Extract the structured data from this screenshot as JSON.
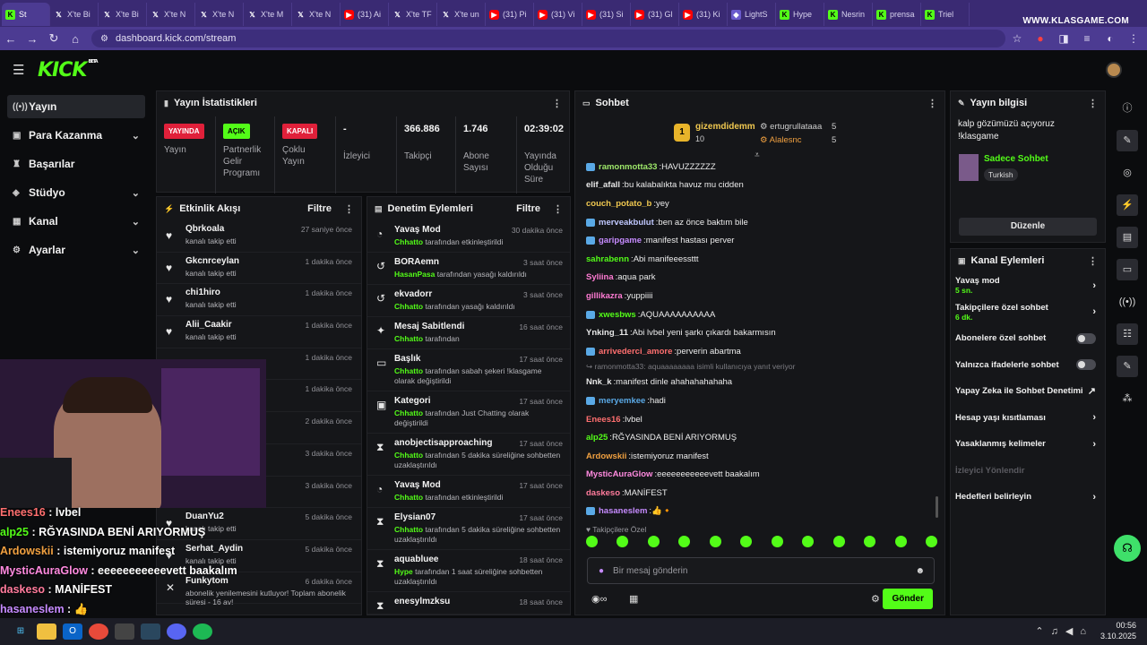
{
  "browser": {
    "tabs": [
      {
        "label": "St",
        "icon": "kick",
        "active": true
      },
      {
        "label": "X'te Bi",
        "icon": "x"
      },
      {
        "label": "X'te Bi",
        "icon": "x"
      },
      {
        "label": "X'te N",
        "icon": "x"
      },
      {
        "label": "X'te N",
        "icon": "x"
      },
      {
        "label": "X'te M",
        "icon": "x"
      },
      {
        "label": "X'te N",
        "icon": "x"
      },
      {
        "label": "(31) Ai",
        "icon": "yt"
      },
      {
        "label": "X'te TF",
        "icon": "x"
      },
      {
        "label": "X'te un",
        "icon": "x"
      },
      {
        "label": "(31) Pi",
        "icon": "yt"
      },
      {
        "label": "(31) Vi",
        "icon": "yt"
      },
      {
        "label": "(31) Si",
        "icon": "yt"
      },
      {
        "label": "(31) Gl",
        "icon": "yt"
      },
      {
        "label": "(31) Ki",
        "icon": "yt"
      },
      {
        "label": "LightS",
        "icon": "g"
      },
      {
        "label": "Hype",
        "icon": "kick"
      },
      {
        "label": "Nesrin",
        "icon": "kick"
      },
      {
        "label": "prensa",
        "icon": "kick"
      },
      {
        "label": "Triel",
        "icon": "kick"
      }
    ],
    "watermark": "WWW.KLASGAME.COM",
    "url": "dashboard.kick.com/stream"
  },
  "sidebar": {
    "items": [
      {
        "label": "Yayın",
        "icon": "stream-icon",
        "active": true,
        "expand": false
      },
      {
        "label": "Para Kazanma",
        "icon": "money-icon",
        "expand": true
      },
      {
        "label": "Başarılar",
        "icon": "trophy-icon",
        "expand": false
      },
      {
        "label": "Stüdyo",
        "icon": "studio-icon",
        "expand": true
      },
      {
        "label": "Kanal",
        "icon": "channel-icon",
        "expand": true
      },
      {
        "label": "Ayarlar",
        "icon": "gear-icon",
        "expand": true
      }
    ]
  },
  "stats": {
    "title": "Yayın İstatistikleri",
    "live_badge": "YAYINDA",
    "live_label": "Yayın",
    "partner_badge": "AÇIK",
    "partner_label": "Partnerlik Gelir Programı",
    "multi_badge": "KAPALI",
    "multi_label": "Çoklu Yayın",
    "viewers_value": "-",
    "viewers_label": "İzleyici",
    "followers_value": "366.886",
    "followers_label": "Takipçi",
    "subs_value": "1.746",
    "subs_label": "Abone Sayısı",
    "uptime_value": "02:39:02",
    "uptime_label": "Yayında Olduğu Süre"
  },
  "activity": {
    "title": "Etkinlik Akışı",
    "filter": "Filtre",
    "rows": [
      {
        "name": "Qbrkoala",
        "sub": "kanalı takip etti",
        "time": "27 saniye önce"
      },
      {
        "name": "Gkcnrceylan",
        "sub": "kanalı takip etti",
        "time": "1 dakika önce"
      },
      {
        "name": "chi1hiro",
        "sub": "kanalı takip etti",
        "time": "1 dakika önce"
      },
      {
        "name": "Alii_Caakir",
        "sub": "kanalı takip etti",
        "time": "1 dakika önce"
      },
      {
        "name": "",
        "sub": "",
        "time": "1 dakika önce"
      },
      {
        "name": "",
        "sub": "",
        "time": "1 dakika önce"
      },
      {
        "name": "",
        "sub": "",
        "time": "2 dakika önce"
      },
      {
        "name": "",
        "sub": "",
        "time": "3 dakika önce"
      },
      {
        "name": "",
        "sub": "",
        "time": "3 dakika önce"
      },
      {
        "name": "DuanYu2",
        "sub": "kanalı takip etti",
        "time": "5 dakika önce"
      },
      {
        "name": "Serhat_Aydin",
        "sub": "kanalı takip etti",
        "time": "5 dakika önce"
      },
      {
        "name": "Funkytom",
        "sub": "abonelik yenilemesini kutluyor! Toplam abonelik süresi - 16 av!",
        "time": "6 dakika önce"
      }
    ]
  },
  "moderation": {
    "title": "Denetim Eylemleri",
    "filter": "Filtre",
    "rows": [
      {
        "name": "Yavaş Mod",
        "actor": "Chhatto",
        "sub": "tarafından etkinleştirildi",
        "time": "30 dakika önce"
      },
      {
        "name": "BORAemn",
        "actor": "HasanPasa",
        "sub": "tarafından yasağı kaldırıldı",
        "time": "3 saat önce"
      },
      {
        "name": "ekvadorr",
        "actor": "Chhatto",
        "sub": "tarafından yasağı kaldırıldı",
        "time": "3 saat önce"
      },
      {
        "name": "Mesaj Sabitlendi",
        "actor": "Chhatto",
        "sub": "tarafından",
        "time": "16 saat önce"
      },
      {
        "name": "Başlık",
        "actor": "Chhatto",
        "sub": "tarafından sabah şekeri !klasgame olarak değiştirildi",
        "time": "17 saat önce"
      },
      {
        "name": "Kategori",
        "actor": "Chhatto",
        "sub": "tarafından Just Chatting olarak değiştirildi",
        "time": "17 saat önce"
      },
      {
        "name": "anobjectisapproaching",
        "actor": "Chhatto",
        "sub": "tarafından 5 dakika süreliğine sohbetten uzaklaştırıldı",
        "time": "17 saat önce"
      },
      {
        "name": "Yavaş Mod",
        "actor": "Chhatto",
        "sub": "tarafından etkinleştirildi",
        "time": "17 saat önce"
      },
      {
        "name": "Elysian07",
        "actor": "Chhatto",
        "sub": "tarafından 5 dakika süreliğine sohbetten uzaklaştırıldı",
        "time": "17 saat önce"
      },
      {
        "name": "aquabluee",
        "actor": "Hype",
        "sub": "tarafından 1 saat süreliğine sohbetten uzaklaştırıldı",
        "time": "18 saat önce"
      },
      {
        "name": "enesylmzksu",
        "actor": "",
        "sub": "",
        "time": "18 saat önce"
      }
    ]
  },
  "chat": {
    "title": "Sohbet",
    "top": [
      {
        "rank": "1",
        "name": "gizemdidemm",
        "count": "10"
      },
      {
        "name": "ertugrullataaa",
        "count": "5"
      },
      {
        "name": "Alalesnc",
        "count": "5"
      }
    ],
    "messages": [
      {
        "user": "ramonmotta33",
        "color": "#9ee86a",
        "text": "HAVUZZZZZZ",
        "badge": true
      },
      {
        "user": "elif_afall",
        "color": "#e8e8e8",
        "text": "bu kalabalıkta havuz mu cidden"
      },
      {
        "user": "couch_potato_b",
        "color": "#f0c850",
        "text": "yey"
      },
      {
        "user": "merveakbulut",
        "color": "#c0c8ff",
        "text": "ben az önce baktım bile",
        "badge": true
      },
      {
        "user": "garipgame",
        "color": "#c68bff",
        "text": "manifest hastası perver",
        "badge": true
      },
      {
        "user": "sahrabenn",
        "color": "#53fc18",
        "text": "Abi manifeeessttt"
      },
      {
        "user": "Syliina",
        "color": "#ff7bd3",
        "text": "aqua park"
      },
      {
        "user": "gillikazra",
        "color": "#ff7bd3",
        "text": "yuppiiii"
      },
      {
        "user": "xwesbws",
        "color": "#53fc18",
        "text": "AQUAAAAAAAAAA",
        "badge": true
      },
      {
        "user": "Ynking_11",
        "color": "#e8e8e8",
        "text": "Abi lvbel yeni şarkı çıkardı bakarmısın"
      },
      {
        "user": "arrivederci_amore",
        "color": "#ff6f6f",
        "text": "perverin abartma",
        "badge": true
      },
      {
        "user": "",
        "color": "#7c7c82",
        "text": "↪ ramonmotta33: aquaaaaaaaa isimli kullanıcıya yanıt veriyor",
        "reply": true
      },
      {
        "user": "Nnk_k",
        "color": "#e8e8e8",
        "text": "manifest dinle ahahahahahaha"
      },
      {
        "user": "meryemkee",
        "color": "#5aa9e6",
        "text": "hadi",
        "badge": true
      },
      {
        "user": "Enees16",
        "color": "#ff6f6f",
        "text": "lvbel"
      },
      {
        "user": "alp25",
        "color": "#53fc18",
        "text": "RĞYASINDA BENİ ARIYORMUŞ"
      },
      {
        "user": "Ardowskii",
        "color": "#f0a040",
        "text": "istemiyoruz manifest"
      },
      {
        "user": "MysticAuraGlow",
        "color": "#ff8adf",
        "text": "eeeeeeeeeeevett baakalım"
      },
      {
        "user": "daskeso",
        "color": "#ff7b9c",
        "text": "MANİFEST"
      },
      {
        "user": "hasaneslem",
        "color": "#c68bff",
        "text": "👍🔸",
        "badge": true
      }
    ],
    "followers_only": "Takipçilere Özel",
    "placeholder": "Bir mesaj gönderin",
    "send": "Gönder"
  },
  "info": {
    "title": "Yayın bilgisi",
    "stream_title": "kalp gözümüzü açıyoruz !klasgame",
    "category": "Sadece Sohbet",
    "language": "Turkish",
    "edit": "Düzenle"
  },
  "actions": {
    "title": "Kanal Eylemleri",
    "rows": [
      {
        "label": "Yavaş mod",
        "sub": "5 sn.",
        "kind": "chev"
      },
      {
        "label": "Takipçilere özel sohbet",
        "sub": "6 dk.",
        "kind": "chev"
      },
      {
        "label": "Abonelere özel sohbet",
        "kind": "toggle"
      },
      {
        "label": "Yalnızca ifadelerle sohbet",
        "kind": "toggle"
      },
      {
        "label": "Yapay Zeka ile Sohbet Denetimi",
        "kind": "ext"
      },
      {
        "label": "Hesap yaşı kısıtlaması",
        "kind": "chev"
      },
      {
        "label": "Yasaklanmış kelimeler",
        "kind": "chev"
      },
      {
        "label": "İzleyici Yönlendir",
        "kind": "disabled"
      },
      {
        "label": "Hedefleri belirleyin",
        "kind": "chev"
      }
    ]
  },
  "overlay_chat": [
    {
      "user": "Enees16",
      "color": "#ff6f6f",
      "text": "lvbel"
    },
    {
      "user": "alp25",
      "color": "#53fc18",
      "text": "RĞYASINDA BENİ ARIYORMUŞ"
    },
    {
      "user": "Ardowskii",
      "color": "#f0a040",
      "text": "istemiyoruz manifest"
    },
    {
      "user": "MysticAuraGlow",
      "color": "#ff8adf",
      "text": "eeeeeeeeeeevett baakalım"
    },
    {
      "user": "daskeso",
      "color": "#ff7b9c",
      "text": "MANİFEST"
    },
    {
      "user": "hasaneslem",
      "color": "#c68bff",
      "text": "👍"
    }
  ],
  "taskbar": {
    "time": "00:56",
    "date": "3.10.2025"
  }
}
